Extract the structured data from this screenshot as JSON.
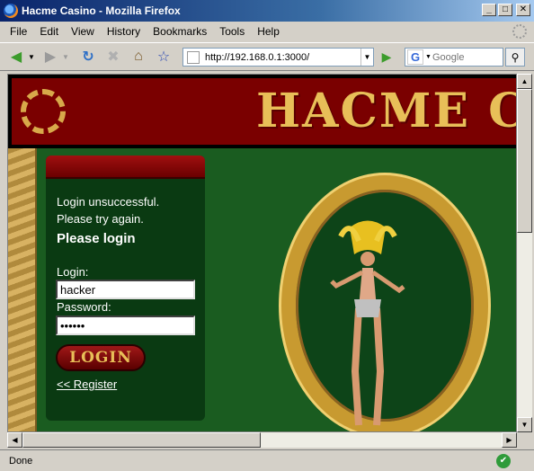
{
  "window": {
    "title": "Hacme Casino - Mozilla Firefox",
    "minimize": "_",
    "maximize": "□",
    "close": "✕"
  },
  "menu": [
    "File",
    "Edit",
    "View",
    "History",
    "Bookmarks",
    "Tools",
    "Help"
  ],
  "nav": {
    "url": "http://192.168.0.1:3000/",
    "search_placeholder": "Google"
  },
  "banner": {
    "title": "HACME CASINO"
  },
  "login": {
    "message_line1": "Login unsuccessful.",
    "message_line2": "Please try again.",
    "heading": "Please login",
    "login_label": "Login:",
    "login_value": "hacker",
    "password_label": "Password:",
    "password_value": "******",
    "button_label": "LOGIN",
    "register_link": "<< Register"
  },
  "status": {
    "text": "Done"
  },
  "colors": {
    "banner": "#7a0000",
    "gold": "#e8bf58",
    "panel": "#0a3a12",
    "page_green": "#1a5c20"
  }
}
